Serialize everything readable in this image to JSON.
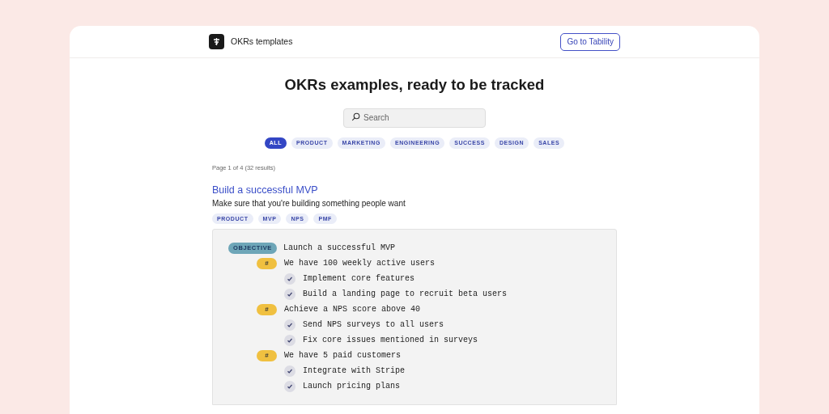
{
  "header": {
    "brand": "OKRs templates",
    "button": "Go to Tability"
  },
  "title": "OKRs examples, ready to be tracked",
  "search": {
    "placeholder": "Search"
  },
  "filters": [
    {
      "label": "ALL",
      "selected": true
    },
    {
      "label": "PRODUCT",
      "selected": false
    },
    {
      "label": "MARKETING",
      "selected": false
    },
    {
      "label": "ENGINEERING",
      "selected": false
    },
    {
      "label": "SUCCESS",
      "selected": false
    },
    {
      "label": "DESIGN",
      "selected": false
    },
    {
      "label": "SALES",
      "selected": false
    }
  ],
  "pagination": "Page 1 of 4 (32 results)",
  "template": {
    "title": "Build a successful MVP",
    "description": "Make sure that you're building something people want",
    "tags": [
      "PRODUCT",
      "MVP",
      "NPS",
      "PMF"
    ],
    "objective": {
      "badge": "OBJECTIVE",
      "text": "Launch a successful MVP",
      "children": [
        {
          "badge": "#",
          "text": "We have 100 weekly active users",
          "children": [
            {
              "text": "Implement core features"
            },
            {
              "text": "Build a landing page to recruit beta users"
            }
          ]
        },
        {
          "badge": "#",
          "text": "Achieve a NPS score above 40",
          "children": [
            {
              "text": "Send NPS surveys to all users"
            },
            {
              "text": "Fix core issues mentioned in surveys"
            }
          ]
        },
        {
          "badge": "#",
          "text": "We have 5 paid customers",
          "children": [
            {
              "text": "Integrate with Stripe"
            },
            {
              "text": "Launch pricing plans"
            }
          ]
        }
      ]
    }
  }
}
